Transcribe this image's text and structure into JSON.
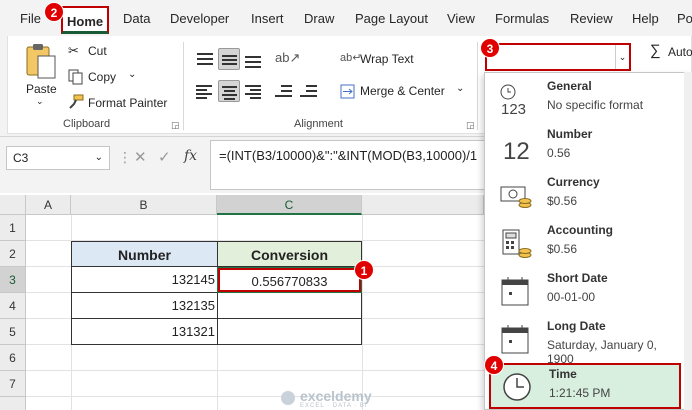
{
  "menu": {
    "items": [
      "File",
      "Home",
      "Data",
      "Developer",
      "Insert",
      "Draw",
      "Page Layout",
      "View",
      "Formulas",
      "Review",
      "Help",
      "Po"
    ]
  },
  "ribbon": {
    "clipboard": {
      "paste": "Paste",
      "cut": "Cut",
      "copy": "Copy",
      "format_painter": "Format Painter",
      "label": "Clipboard"
    },
    "alignment": {
      "wrap_text": "Wrap Text",
      "merge_center": "Merge & Center",
      "label": "Alignment"
    },
    "editing": {
      "autosum": "Auto"
    },
    "number_format": {
      "value": ""
    }
  },
  "formula_bar": {
    "name_box": "C3",
    "fx": "fx",
    "formula": "=(INT(B3/10000)&\":\"&INT(MOD(B3,10000)/1"
  },
  "grid": {
    "columns": [
      "A",
      "B",
      "C"
    ],
    "rows": [
      "1",
      "2",
      "3",
      "4",
      "5",
      "6",
      "7"
    ],
    "table": {
      "headers": [
        "Number",
        "Conversion"
      ],
      "rows": [
        {
          "number": "132145",
          "conversion": "0.556770833"
        },
        {
          "number": "132135",
          "conversion": ""
        },
        {
          "number": "131321",
          "conversion": ""
        }
      ]
    }
  },
  "format_dropdown": {
    "items": [
      {
        "title": "General",
        "sub": "No specific format",
        "icon": "general-123-icon"
      },
      {
        "title": "Number",
        "sub": "0.56",
        "icon": "number-12-icon"
      },
      {
        "title": "Currency",
        "sub": "$0.56",
        "icon": "currency-icon"
      },
      {
        "title": "Accounting",
        "sub": " $0.56",
        "icon": "accounting-icon"
      },
      {
        "title": "Short Date",
        "sub": "00-01-00",
        "icon": "calendar-icon"
      },
      {
        "title": "Long Date",
        "sub": "Saturday, January 0, 1900",
        "icon": "calendar-icon"
      },
      {
        "title": "Time",
        "sub": "1:21:45 PM",
        "icon": "clock-icon"
      }
    ]
  },
  "badges": [
    "1",
    "2",
    "3",
    "4"
  ],
  "watermark": {
    "name": "exceldemy",
    "tagline": "EXCEL · DATA · BI"
  },
  "colors": {
    "accent": "#217346",
    "highlight": "#c00000",
    "selected_item": "#d8efdf"
  }
}
